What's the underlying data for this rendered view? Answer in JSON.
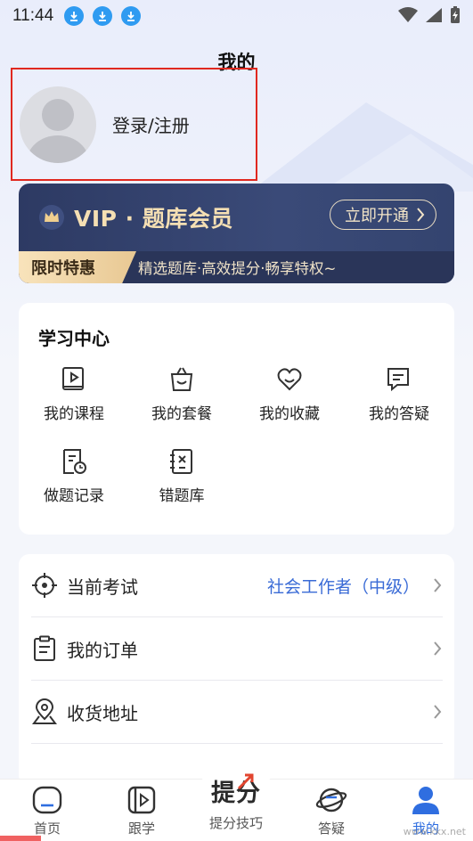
{
  "status_bar": {
    "time": "11:44"
  },
  "header": {
    "title": "我的"
  },
  "profile": {
    "login_label": "登录/注册"
  },
  "vip": {
    "title": "VIP · 题库会员",
    "cta": "立即开通",
    "badge": "限时特惠",
    "desc": "精选题库·高效提分·畅享特权~",
    "colors": {
      "card": "#2d3a63",
      "gold": "#f5dfb3"
    }
  },
  "study_center": {
    "title": "学习中心",
    "items": [
      {
        "label": "我的课程",
        "icon": "course-icon"
      },
      {
        "label": "我的套餐",
        "icon": "package-icon"
      },
      {
        "label": "我的收藏",
        "icon": "favorite-icon"
      },
      {
        "label": "我的答疑",
        "icon": "qa-icon"
      },
      {
        "label": "做题记录",
        "icon": "record-icon"
      },
      {
        "label": "错题库",
        "icon": "wrong-questions-icon"
      }
    ]
  },
  "list": {
    "items": [
      {
        "label": "当前考试",
        "value": "社会工作者（中级）",
        "icon": "target-icon"
      },
      {
        "label": "我的订单",
        "value": "",
        "icon": "order-icon"
      },
      {
        "label": "收货地址",
        "value": "",
        "icon": "location-icon"
      }
    ]
  },
  "bottom_nav": {
    "items": [
      {
        "label": "首页",
        "icon": "home-icon"
      },
      {
        "label": "跟学",
        "icon": "video-icon"
      },
      {
        "label": "提分技巧",
        "icon": "tips-icon",
        "logo": "提分"
      },
      {
        "label": "答疑",
        "icon": "planet-icon"
      },
      {
        "label": "我的",
        "icon": "user-icon"
      }
    ],
    "active": "我的",
    "accent": "#2f6ee0"
  },
  "watermark": "www.kkx.net"
}
